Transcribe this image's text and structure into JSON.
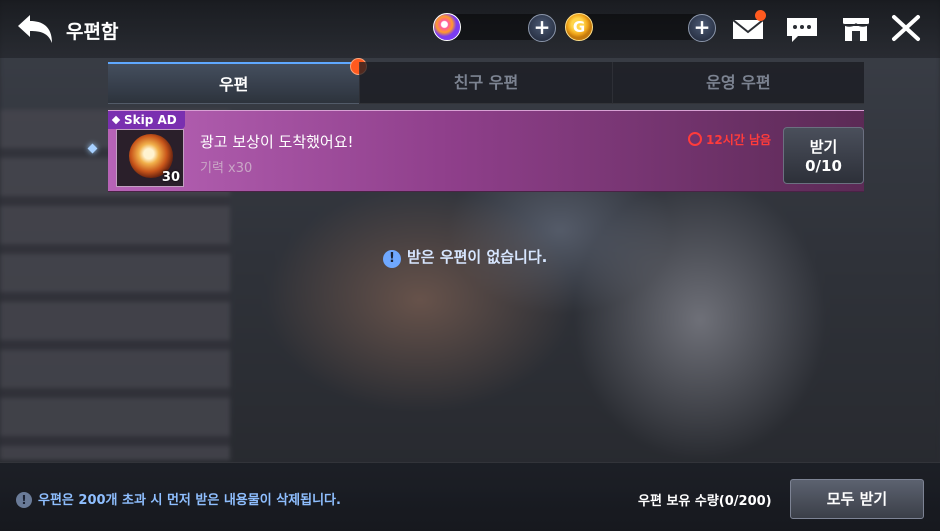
{
  "header": {
    "title": "우편함",
    "back_icon": "back-arrow-icon",
    "currencies": [
      {
        "name": "gem",
        "icon": "gem-icon"
      },
      {
        "name": "gold",
        "icon": "gold-coin-icon",
        "symbol": "G"
      }
    ],
    "plus_label": "+",
    "icons": [
      "mail-icon",
      "chat-icon",
      "shop-icon",
      "close-icon"
    ]
  },
  "tabs": [
    {
      "label": "우편",
      "active": true,
      "has_alert": true
    },
    {
      "label": "친구 우편",
      "active": false
    },
    {
      "label": "운영 우편",
      "active": false
    }
  ],
  "mail_items": [
    {
      "tag": "Skip AD",
      "title": "광고 보상이 도착했어요!",
      "subtitle": "기력 x30",
      "quantity": "30",
      "time_left": "12시간 남음",
      "claim_label": "받기",
      "claim_count": "0/10"
    }
  ],
  "empty_message": "받은 우편이 없습니다.",
  "footer": {
    "notice": "우편은 200개 초과 시 먼저 받은 내용물이 삭제됩니다.",
    "storage": "우편 보유 수량(0/200)",
    "claim_all_label": "모두 받기"
  },
  "colors": {
    "accent": "#5fa8ff",
    "alert": "#ff5a1f",
    "timer": "#ff3b3b",
    "mail_item_bg": "#b763b6"
  }
}
